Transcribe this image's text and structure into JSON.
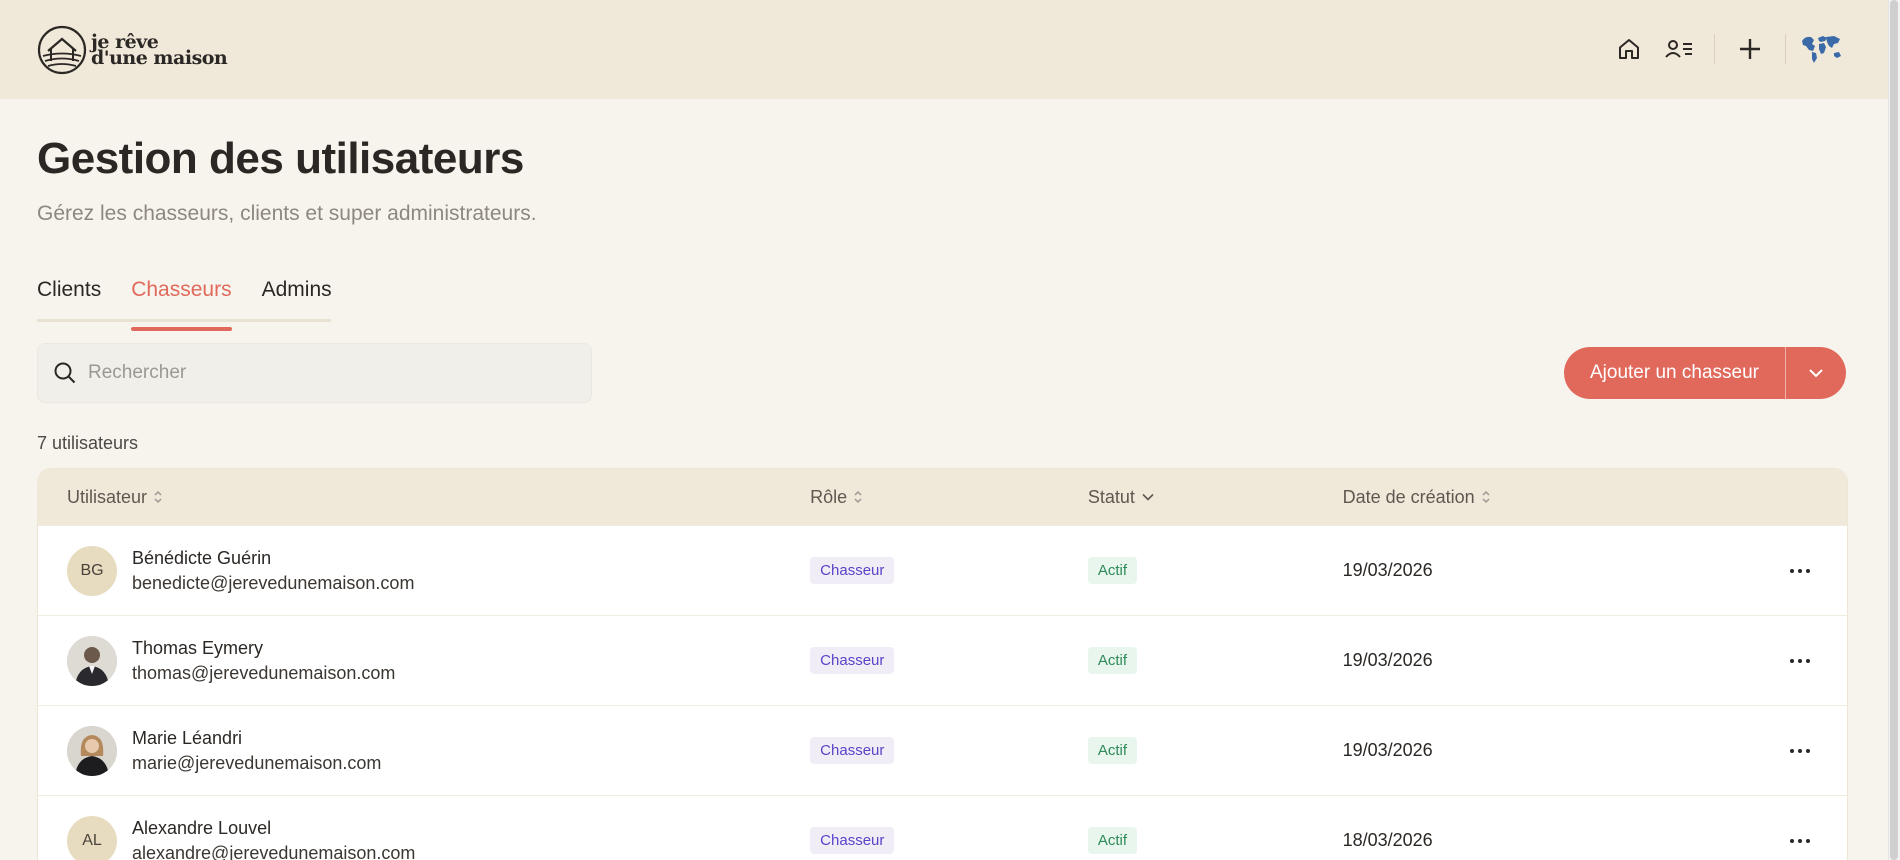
{
  "brand": {
    "line1": "je rêve",
    "line2": "d'une maison"
  },
  "page": {
    "title": "Gestion des utilisateurs",
    "subtitle": "Gérez les chasseurs, clients et super administrateurs."
  },
  "tabs": [
    {
      "label": "Clients",
      "active": false
    },
    {
      "label": "Chasseurs",
      "active": true
    },
    {
      "label": "Admins",
      "active": false
    }
  ],
  "search": {
    "placeholder": "Rechercher"
  },
  "add_button": {
    "label": "Ajouter un chasseur"
  },
  "count_text": "7 utilisateurs",
  "table": {
    "headers": {
      "user": "Utilisateur",
      "role": "Rôle",
      "status": "Statut",
      "date": "Date de création"
    },
    "rows": [
      {
        "initials": "BG",
        "photo": false,
        "name": "Bénédicte Guérin",
        "email": "benedicte@jerevedunemaison.com",
        "role": "Chasseur",
        "status": "Actif",
        "date": "19/03/2026"
      },
      {
        "initials": "",
        "photo": true,
        "name": "Thomas Eymery",
        "email": "thomas@jerevedunemaison.com",
        "role": "Chasseur",
        "status": "Actif",
        "date": "19/03/2026"
      },
      {
        "initials": "",
        "photo": true,
        "name": "Marie Léandri",
        "email": "marie@jerevedunemaison.com",
        "role": "Chasseur",
        "status": "Actif",
        "date": "19/03/2026"
      },
      {
        "initials": "AL",
        "photo": false,
        "name": "Alexandre Louvel",
        "email": "alexandre@jerevedunemaison.com",
        "role": "Chasseur",
        "status": "Actif",
        "date": "18/03/2026"
      }
    ]
  },
  "colors": {
    "accent": "#e0695c",
    "topbar": "#f0e9da",
    "background": "#f7f4ed",
    "role_badge": "#5b43c9",
    "status_badge": "#2e8a57"
  },
  "icons": [
    "home-icon",
    "users-list-icon",
    "plus-icon",
    "globe-icon",
    "search-icon",
    "chevron-down-icon",
    "sort-icon",
    "more-icon"
  ]
}
